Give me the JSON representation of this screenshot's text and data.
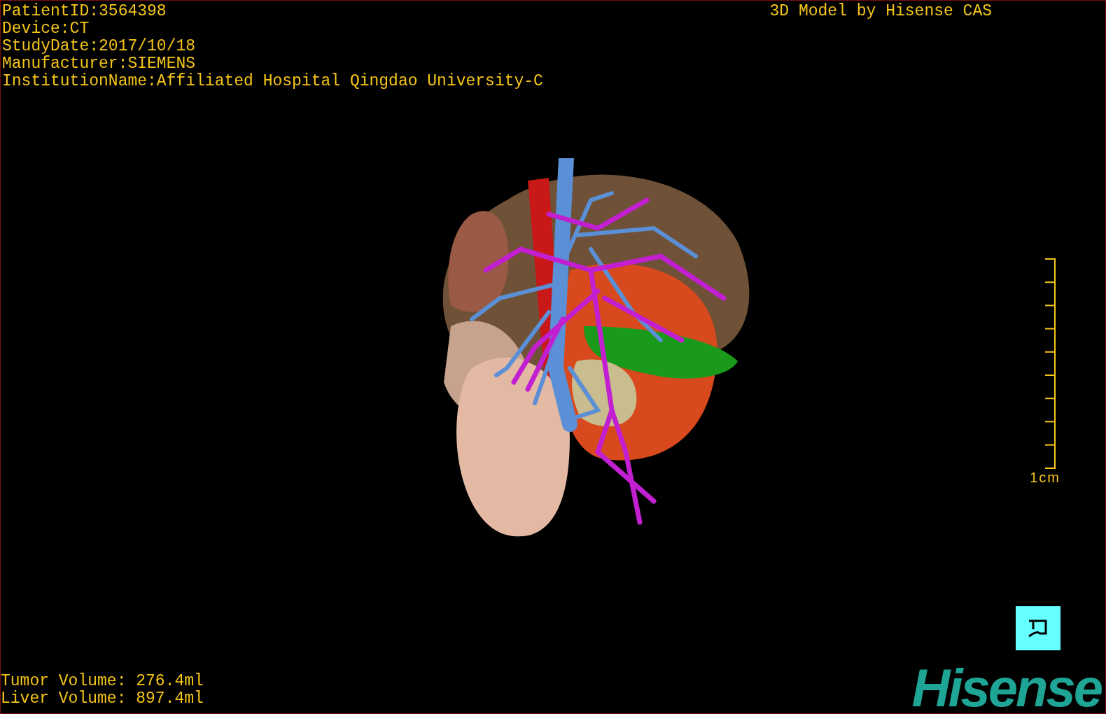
{
  "study_info": [
    "PatientID:3564398",
    "Device:CT",
    "StudyDate:2017/10/18",
    "Manufacturer:SIEMENS",
    "InstitutionName:Affiliated Hospital Qingdao University-C"
  ],
  "model_caption": "3D Model by Hisense CAS",
  "scale_bar": {
    "label": "1cm"
  },
  "volumes": [
    "Tumor Volume: 276.4ml",
    "Liver Volume: 897.4ml"
  ],
  "logo": "Hisense"
}
